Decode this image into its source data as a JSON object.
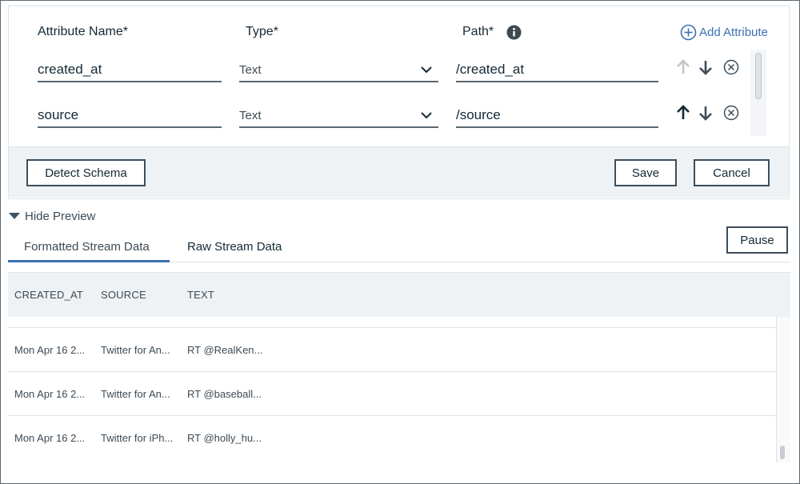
{
  "schema": {
    "columns": {
      "attribute_name": "Attribute Name*",
      "type": "Type*",
      "path": "Path*"
    },
    "add_attribute_label": "Add Attribute",
    "rows": [
      {
        "name": "created_at",
        "type": "Text",
        "path": "/created_at",
        "move_up_enabled": false
      },
      {
        "name": "source",
        "type": "Text",
        "path": "/source",
        "move_up_enabled": true
      }
    ],
    "buttons": {
      "detect_schema": "Detect Schema",
      "save": "Save",
      "cancel": "Cancel"
    }
  },
  "preview": {
    "toggle_label": "Hide Preview",
    "tabs": [
      {
        "label": "Formatted Stream Data",
        "active": true
      },
      {
        "label": "Raw Stream Data",
        "active": false
      }
    ],
    "pause_label": "Pause",
    "table": {
      "headers": [
        "CREATED_AT",
        "SOURCE",
        "TEXT"
      ],
      "rows": [
        [
          "Mon Apr 16 2...",
          "Twitter for An...",
          "RT @RealKen..."
        ],
        [
          "Mon Apr 16 2...",
          "Twitter for An...",
          "RT @baseball..."
        ],
        [
          "Mon Apr 16 2...",
          "Twitter for iPh...",
          "RT @holly_hu..."
        ]
      ]
    }
  },
  "colors": {
    "accent": "#3d70b2",
    "text": "#152935",
    "panel_bg": "#eef2f5",
    "disabled_icon": "#c0c6ca"
  },
  "icons": {
    "info": "info-icon",
    "add": "add-circle-icon",
    "chevron": "chevron-down-icon",
    "move_up": "arrow-up-icon",
    "move_down": "arrow-down-icon",
    "remove": "close-circle-icon",
    "collapse": "caret-down-icon"
  }
}
